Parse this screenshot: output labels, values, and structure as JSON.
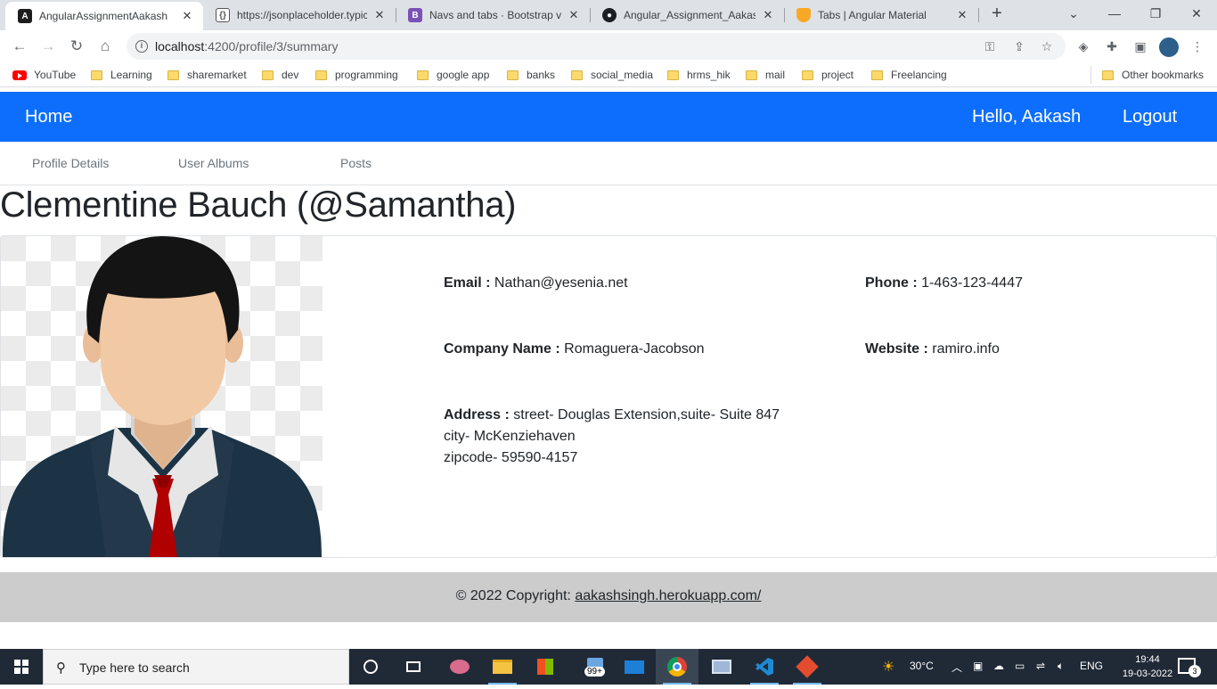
{
  "browser": {
    "tabs": [
      {
        "title": "AngularAssignmentAakash",
        "active": true
      },
      {
        "title": "https://jsonplaceholder.typicode.com"
      },
      {
        "title": "Navs and tabs · Bootstrap v5.0"
      },
      {
        "title": "Angular_Assignment_Aakash"
      },
      {
        "title": "Tabs | Angular Material"
      }
    ],
    "new_tab": "+",
    "url_host": "localhost",
    "url_path": ":4200/profile/3/summary",
    "bookmarks": [
      "YouTube",
      "Learning",
      "sharemarket",
      "dev",
      "programming",
      "google app",
      "banks",
      "social_media",
      "hrms_hik",
      "mail",
      "project",
      "Freelancing"
    ],
    "other_bookmarks": "Other bookmarks"
  },
  "navbar": {
    "home": "Home",
    "greeting": "Hello, Aakash",
    "logout": "Logout",
    "color": "#0d6efd"
  },
  "profile_tabs": [
    "Profile Details",
    "User Albums",
    "Posts"
  ],
  "profile": {
    "name": "Clementine Bauch (@Samantha)",
    "email_label": "Email :",
    "email": "Nathan@yesenia.net",
    "phone_label": "Phone :",
    "phone": "1-463-123-4447",
    "company_label": "Company Name :",
    "company": "Romaguera-Jacobson",
    "website_label": "Website :",
    "website": "ramiro.info",
    "address_label": "Address :",
    "address_line1": "street- Douglas Extension,suite- Suite 847",
    "address_line2": "city- McKenziehaven",
    "address_line3": "zipcode- 59590-4157"
  },
  "footer": {
    "copyright": "© 2022 Copyright:",
    "link": "aakashsingh.herokuapp.com/"
  },
  "taskbar": {
    "search_placeholder": "Type here to search",
    "weather": "30°C",
    "language": "ENG",
    "time": "19:44",
    "date": "19-03-2022",
    "badge": "99+",
    "notifications": "3"
  }
}
